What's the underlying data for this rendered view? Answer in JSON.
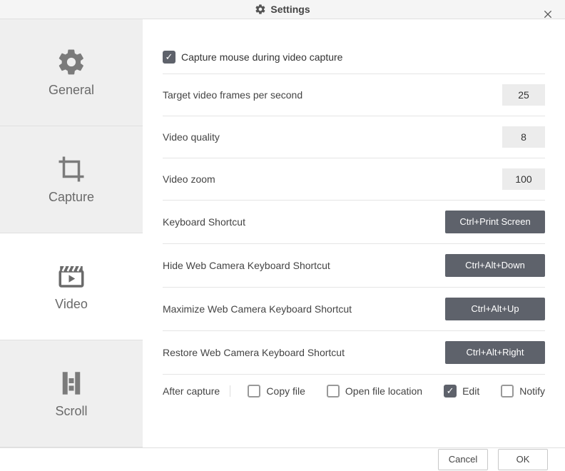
{
  "titlebar": {
    "title": "Settings"
  },
  "sidebar": {
    "items": [
      {
        "label": "General"
      },
      {
        "label": "Capture"
      },
      {
        "label": "Video"
      },
      {
        "label": "Scroll"
      }
    ]
  },
  "main": {
    "capture_mouse_label": "Capture mouse during video capture",
    "capture_mouse_checked": true,
    "rows": [
      {
        "label": "Target video frames per second",
        "value": "25"
      },
      {
        "label": "Video quality",
        "value": "8"
      },
      {
        "label": "Video zoom",
        "value": "100"
      }
    ],
    "shortcuts": [
      {
        "label": "Keyboard Shortcut",
        "value": "Ctrl+Print Screen"
      },
      {
        "label": "Hide Web Camera Keyboard Shortcut",
        "value": "Ctrl+Alt+Down"
      },
      {
        "label": "Maximize Web Camera Keyboard Shortcut",
        "value": "Ctrl+Alt+Up"
      },
      {
        "label": "Restore Web Camera Keyboard Shortcut",
        "value": "Ctrl+Alt+Right"
      }
    ],
    "after_capture": {
      "label": "After capture",
      "options": [
        {
          "label": "Copy file",
          "checked": false
        },
        {
          "label": "Open file location",
          "checked": false
        },
        {
          "label": "Edit",
          "checked": true
        },
        {
          "label": "Notify",
          "checked": false
        }
      ]
    }
  },
  "footer": {
    "cancel": "Cancel",
    "ok": "OK"
  }
}
